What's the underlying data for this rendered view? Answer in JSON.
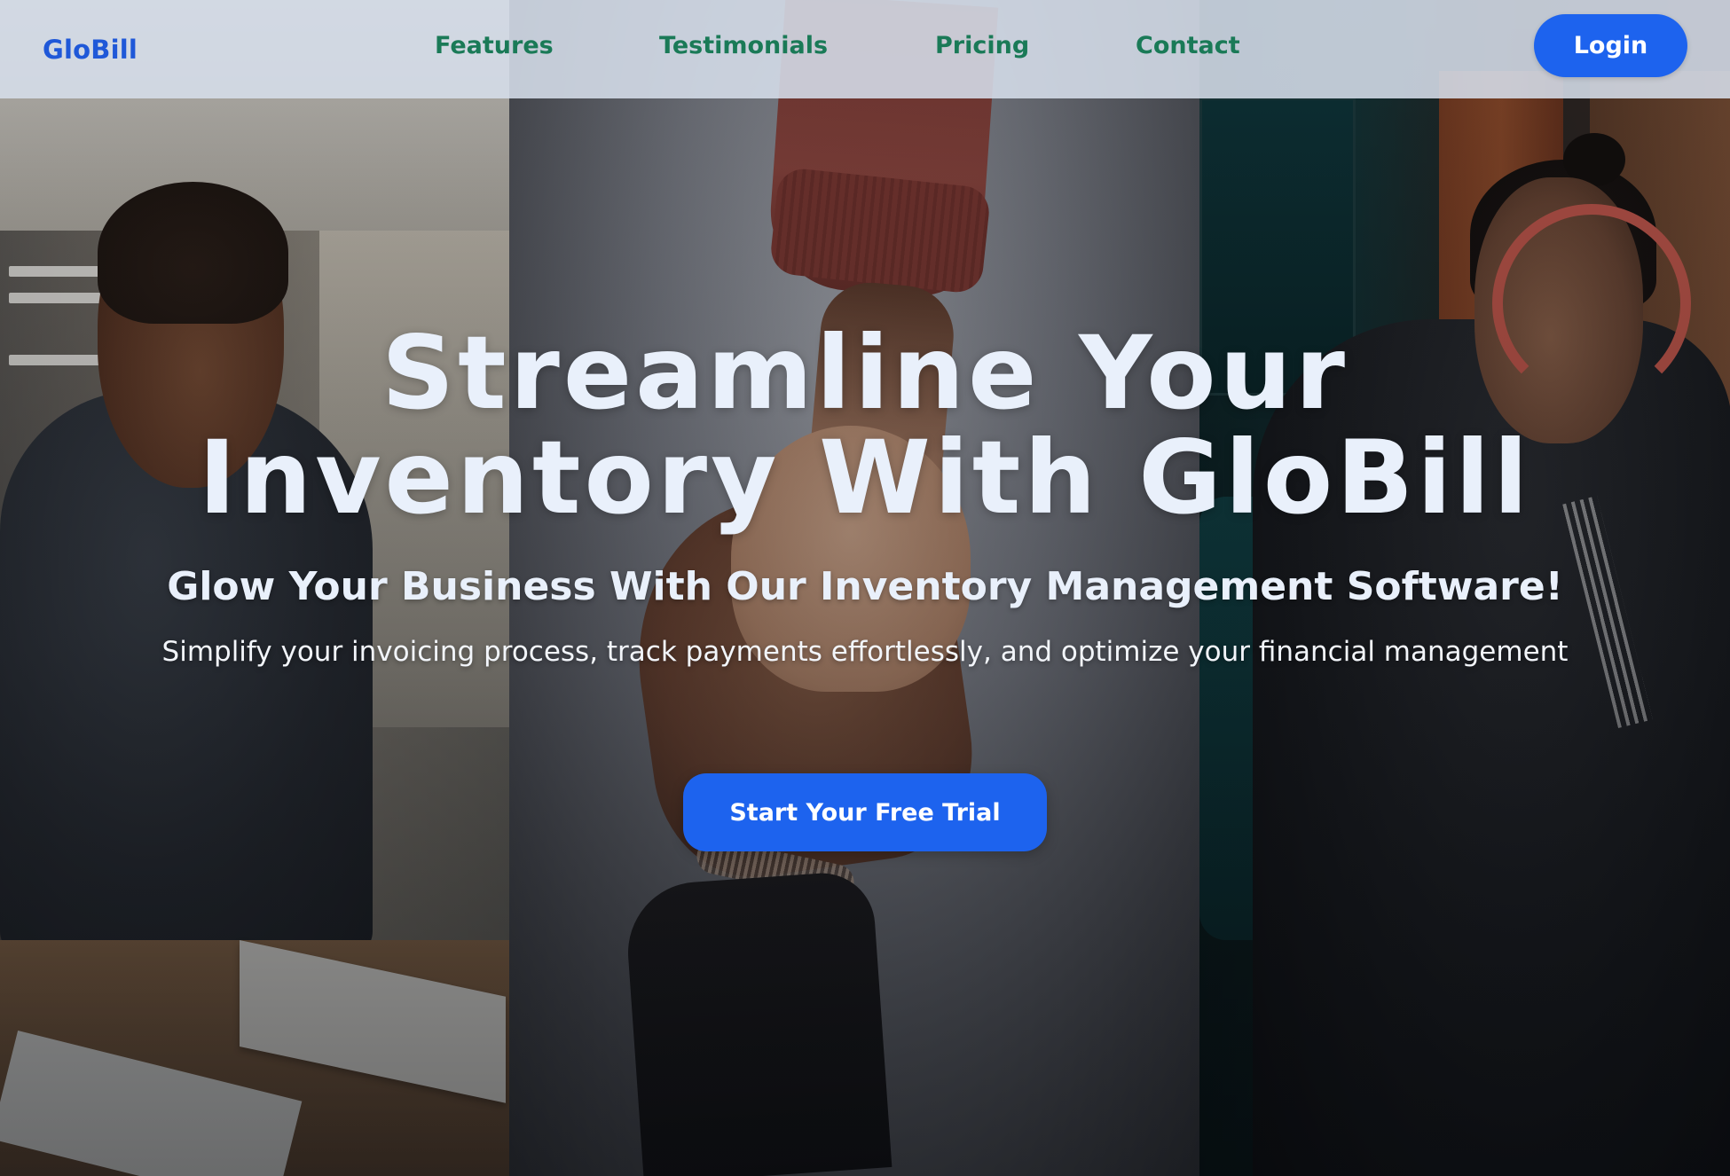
{
  "nav": {
    "brand": "GloBill",
    "links": [
      {
        "label": "Features"
      },
      {
        "label": "Testimonials"
      },
      {
        "label": "Pricing"
      },
      {
        "label": "Contact"
      }
    ],
    "login_label": "Login"
  },
  "hero": {
    "title_line1": "Streamline Your",
    "title_line2": "Inventory With GloBill",
    "subtitle": "Glow Your Business With Our Inventory Management Software!",
    "description": "Simplify your invoicing process, track payments effortlessly, and optimize your financial management",
    "cta_label": "Start Your Free Trial"
  },
  "colors": {
    "brand": "#1f58d8",
    "nav_link": "#1a7a57",
    "button": "#1d63ee",
    "hero_text": "#e9f0fb",
    "navbar_bg": "#d6deea"
  }
}
